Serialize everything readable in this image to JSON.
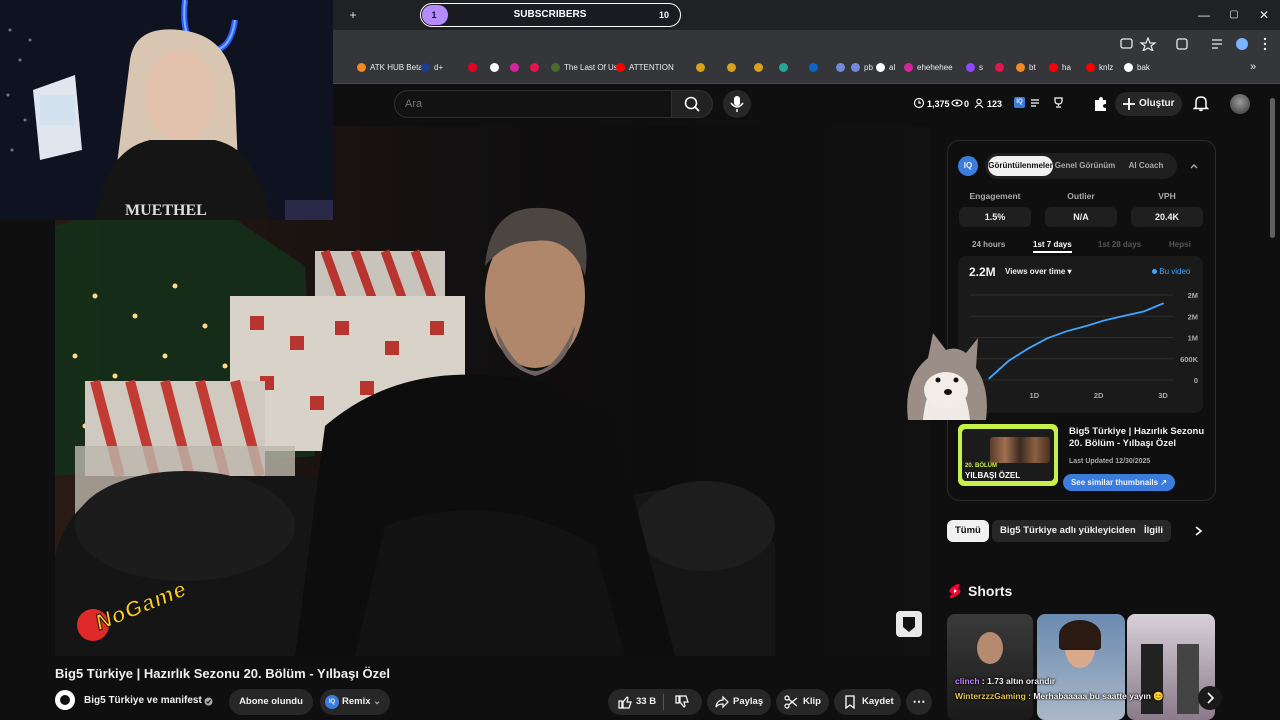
{
  "overlay": {
    "subscribers_label": "SUBSCRIBERS",
    "current": "1",
    "goal": "10",
    "progress": 0.1,
    "watermark": "NoGame"
  },
  "browser": {
    "new_tab": "+",
    "window_controls": [
      "—",
      "▢",
      "✕"
    ],
    "bookmarks": [
      {
        "label": "ATK HUB Beta",
        "color": "#f08a24"
      },
      {
        "label": "d+",
        "color": "#1e3c8c"
      },
      {
        "label": "",
        "color": "#e60023"
      },
      {
        "label": "",
        "color": "#ffffff"
      },
      {
        "label": "",
        "color": "#d6249f"
      },
      {
        "label": "",
        "color": "#e5144b"
      },
      {
        "label": "The Last Of Us",
        "color": "#4a6a2f"
      },
      {
        "label": "ATTENTION",
        "color": "#ff0000"
      },
      {
        "label": "",
        "color": "#d8a21e"
      },
      {
        "label": "",
        "color": "#d8a21e"
      },
      {
        "label": "",
        "color": "#d8a21e"
      },
      {
        "label": "",
        "color": "#26a69a"
      },
      {
        "label": "",
        "color": "#0a66c2"
      },
      {
        "label": "",
        "color": "#7289da"
      },
      {
        "label": "pb",
        "color": "#7289da"
      },
      {
        "label": "al",
        "color": "#ffffff"
      },
      {
        "label": "ehehehee",
        "color": "#d6249f"
      },
      {
        "label": "s",
        "color": "#9147ff"
      },
      {
        "label": "",
        "color": "#e5144b"
      },
      {
        "label": "bt",
        "color": "#f08a24"
      },
      {
        "label": "ha",
        "color": "#ff0000"
      },
      {
        "label": "knlz",
        "color": "#ff0000"
      },
      {
        "label": "bak",
        "color": "#ffffff"
      }
    ],
    "more": "»"
  },
  "header": {
    "search_placeholder": "Ara",
    "stats": [
      "1,375",
      "0",
      "123"
    ],
    "create_label": "Oluştur"
  },
  "panel": {
    "badge": "IQ",
    "tabs": [
      "Görüntülenmeler",
      "Genel Görünüm",
      "AI Coach"
    ],
    "metrics": [
      {
        "label": "Engagement",
        "value": "1.5%"
      },
      {
        "label": "Outlier",
        "value": "N/A"
      },
      {
        "label": "VPH",
        "value": "20.4K"
      }
    ],
    "periods": [
      "24 hours",
      "1st 7 days",
      "1st 28 days",
      "Hepsi"
    ],
    "active_period": 1,
    "total_views": "2.2M",
    "dropdown": "Views over time",
    "legend": "Bu video",
    "video_title": "Big5 Türkiye | Hazırlık Sezonu 20. Bölüm - Yılbaşı Özel",
    "last_updated": "Last Updated 12/30/2025",
    "similar_button": "See similar thumbnails ↗",
    "thumb_text": [
      "20. BÖLÜM",
      "YILBAŞI ÖZEL"
    ]
  },
  "chart_data": {
    "type": "line",
    "x_ticks": [
      "1D",
      "2D",
      "3D"
    ],
    "y_ticks": [
      "2M",
      "2M",
      "1M",
      "600K",
      "0"
    ],
    "series": [
      {
        "name": "Bu video",
        "color": "#3ea6ff",
        "points": [
          [
            0.3,
            0.05
          ],
          [
            0.6,
            0.55
          ],
          [
            0.9,
            0.9
          ],
          [
            1.2,
            1.2
          ],
          [
            1.5,
            1.4
          ],
          [
            1.8,
            1.55
          ],
          [
            2.1,
            1.72
          ],
          [
            2.4,
            1.85
          ],
          [
            2.7,
            1.97
          ],
          [
            3.0,
            2.2
          ]
        ]
      }
    ],
    "xlim": [
      0,
      3
    ],
    "ylim": [
      0,
      2.2
    ]
  },
  "chips": [
    "Tümü",
    "Big5 Türkiye adlı yükleyiciden",
    "İlgili"
  ],
  "shorts_title": "Shorts",
  "chat": [
    {
      "user": "clinch",
      "text": " : 1.73 altın orandır",
      "color": "#c77dff"
    },
    {
      "user": "WinterzzzGaming",
      "text": " : Merhabaaaaa bu saatte yayın 😊",
      "color": "#e0c050"
    }
  ],
  "video": {
    "title": "Big5 Türkiye | Hazırlık Sezonu 20. Bölüm - Yılbaşı Özel",
    "channel": "Big5 Türkiye ve manifest",
    "subscribe": "Abone olundu",
    "remix": "Remix",
    "likes": "33 B",
    "share": "Paylaş",
    "clip": "Klip",
    "save": "Kaydet",
    "more": "⋯"
  }
}
